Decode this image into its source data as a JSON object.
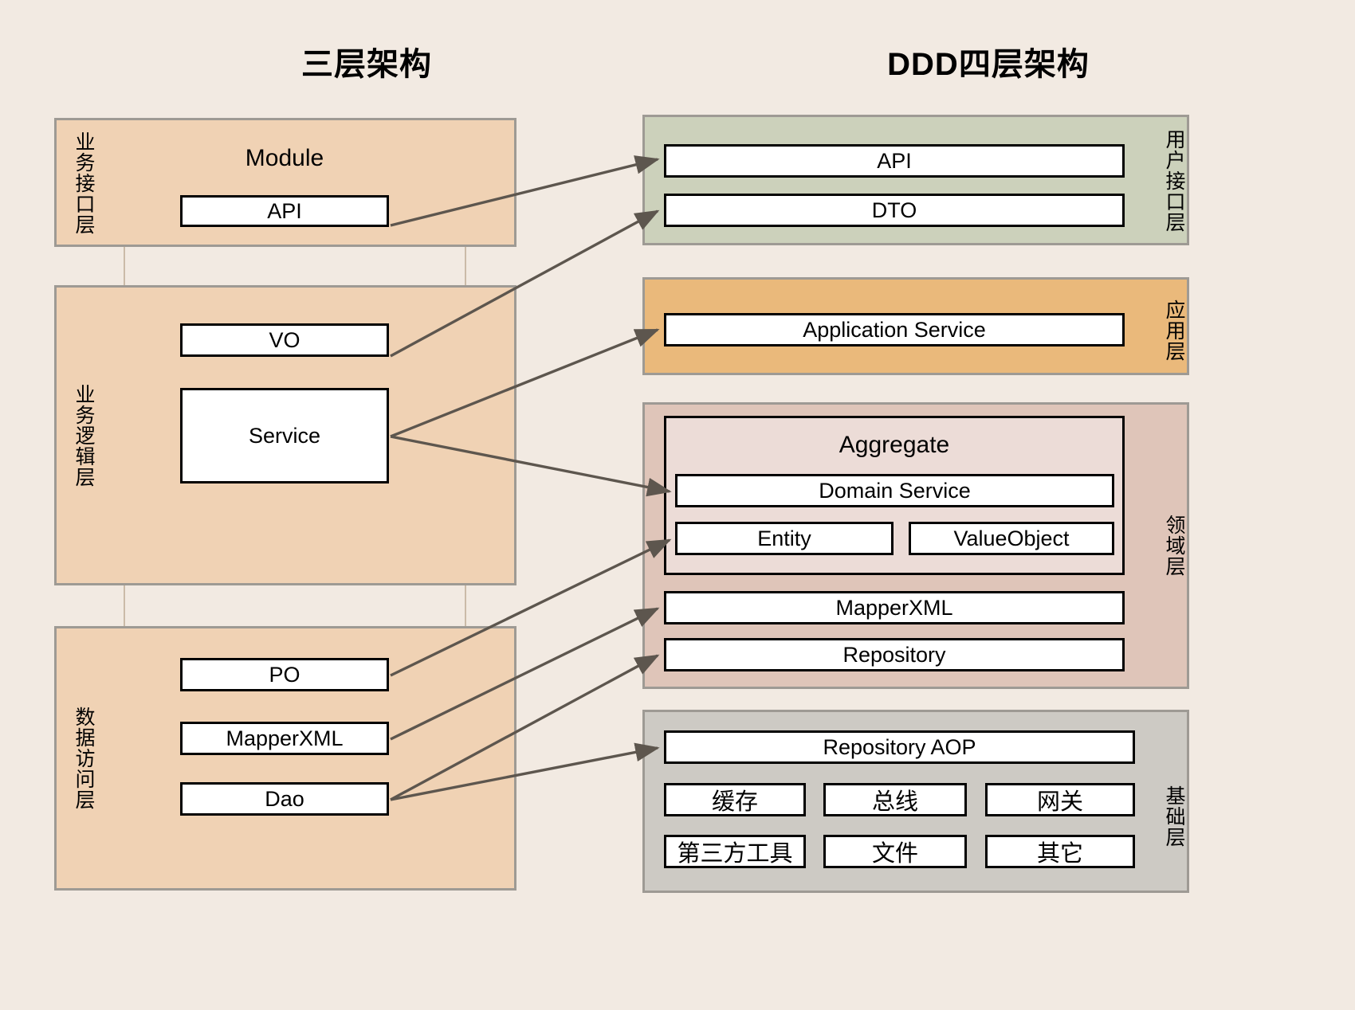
{
  "titles": {
    "left": "三层架构",
    "right": "DDD四层架构"
  },
  "colors": {
    "background": "#f2eae2",
    "three_tier_panel": "#f0d2b4",
    "three_tier_border": "#9e9a94",
    "module_border": "#cbbba8",
    "ui_layer": "#ccd1bb",
    "application_layer": "#eab97b",
    "domain_layer": "#dfc5b9",
    "aggregate": "#ecdcd7",
    "infrastructure_layer": "#cdcac4",
    "box_fill": "#ffffff",
    "box_border": "#000000",
    "arrow": "#5d564e"
  },
  "left_architecture": {
    "name": "三层架构",
    "module_label": "Module",
    "layers": [
      {
        "id": "business-interface",
        "label": "业务接口层",
        "boxes": [
          "API"
        ]
      },
      {
        "id": "business-logic",
        "label": "业务逻辑层",
        "boxes": [
          "VO",
          "Service"
        ]
      },
      {
        "id": "data-access",
        "label": "数据访问层",
        "boxes": [
          "PO",
          "MapperXML",
          "Dao"
        ]
      }
    ]
  },
  "right_architecture": {
    "name": "DDD四层架构",
    "layers": [
      {
        "id": "user-interface",
        "label": "用户接口层",
        "boxes": [
          "API",
          "DTO"
        ]
      },
      {
        "id": "application",
        "label": "应用层",
        "boxes": [
          "Application Service"
        ]
      },
      {
        "id": "domain",
        "label": "领域层",
        "aggregate_label": "Aggregate",
        "aggregate_boxes": [
          "Domain Service",
          "Entity",
          "ValueObject"
        ],
        "boxes": [
          "MapperXML",
          "Repository"
        ]
      },
      {
        "id": "infrastructure",
        "label": "基础层",
        "boxes": [
          "Repository AOP",
          "缓存",
          "总线",
          "网关",
          "第三方工具",
          "文件",
          "其它"
        ]
      }
    ]
  },
  "mappings": [
    {
      "from": "API",
      "to": "API"
    },
    {
      "from": "VO",
      "to": "DTO"
    },
    {
      "from": "Service",
      "to": "Application Service"
    },
    {
      "from": "Service",
      "to": "Domain Service"
    },
    {
      "from": "PO",
      "to": "Entity"
    },
    {
      "from": "MapperXML",
      "to": "MapperXML"
    },
    {
      "from": "Dao",
      "to": "Repository"
    },
    {
      "from": "Dao",
      "to": "Repository AOP"
    }
  ]
}
